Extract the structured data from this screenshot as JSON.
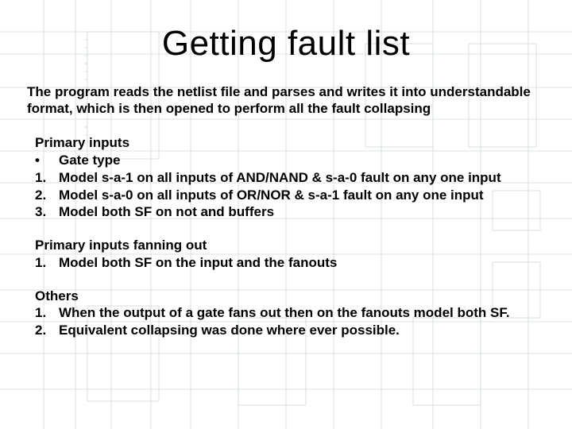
{
  "title": "Getting fault list",
  "intro": "The program reads the netlist file and parses and writes it into understandable format, which is then opened to perform all the fault collapsing",
  "section1": {
    "head": "Primary inputs",
    "bullet_mk": "•",
    "bullet": "Gate type",
    "i1_mk": "1.",
    "i1": "Model s-a-1 on all inputs of AND/NAND & s-a-0 fault on any one input",
    "i2_mk": "2.",
    "i2": "Model s-a-0 on all inputs of OR/NOR & s-a-1 fault on any one input",
    "i3_mk": "3.",
    "i3": "Model both SF on not and buffers"
  },
  "section2": {
    "head": "Primary inputs fanning out",
    "i1_mk": "1.",
    "i1": "Model both SF on the input and the fanouts"
  },
  "section3": {
    "head": "Others",
    "i1_mk": "1.",
    "i1": "When the output of a gate fans out then on the fanouts model both SF.",
    "i2_mk": "2.",
    "i2": "Equivalent collapsing was done where ever possible."
  }
}
